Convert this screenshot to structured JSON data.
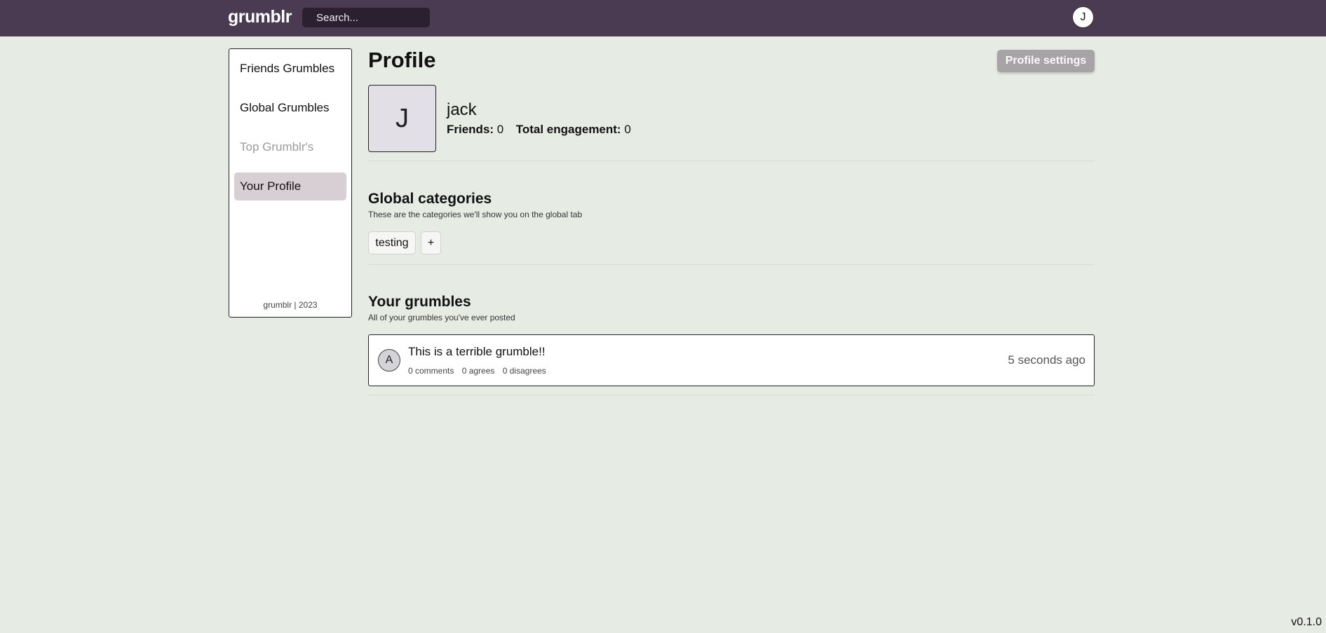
{
  "header": {
    "logo": "grumblr",
    "search_placeholder": "Search...",
    "user_initial": "J"
  },
  "sidebar": {
    "items": [
      {
        "label": "Friends Grumbles",
        "state": "normal"
      },
      {
        "label": "Global Grumbles",
        "state": "normal"
      },
      {
        "label": "Top Grumblr's",
        "state": "disabled"
      },
      {
        "label": "Your Profile",
        "state": "active"
      }
    ],
    "footer": "grumblr | 2023"
  },
  "profile": {
    "title": "Profile",
    "settings_label": "Profile settings",
    "avatar_initial": "J",
    "username": "jack",
    "friends_label": "Friends:",
    "friends_count": "0",
    "engagement_label": "Total engagement:",
    "engagement_count": "0"
  },
  "categories": {
    "title": "Global categories",
    "subtitle": "These are the categories we'll show you on the global tab",
    "items": [
      "testing"
    ],
    "add_label": "+"
  },
  "grumbles": {
    "title": "Your grumbles",
    "subtitle": "All of your grumbles you've ever posted",
    "items": [
      {
        "avatar_initial": "A",
        "text": "This is a terrible grumble!!",
        "comments": "0 comments",
        "agrees": "0 agrees",
        "disagrees": "0 disagrees",
        "time": "5 seconds ago"
      }
    ]
  },
  "footer": {
    "version": "v0.1.0"
  },
  "colors": {
    "topbar": "#4a3a52",
    "background": "#e6ebe3",
    "active_nav": "#d8cfd5",
    "settings_button": "#a8a3a6"
  }
}
